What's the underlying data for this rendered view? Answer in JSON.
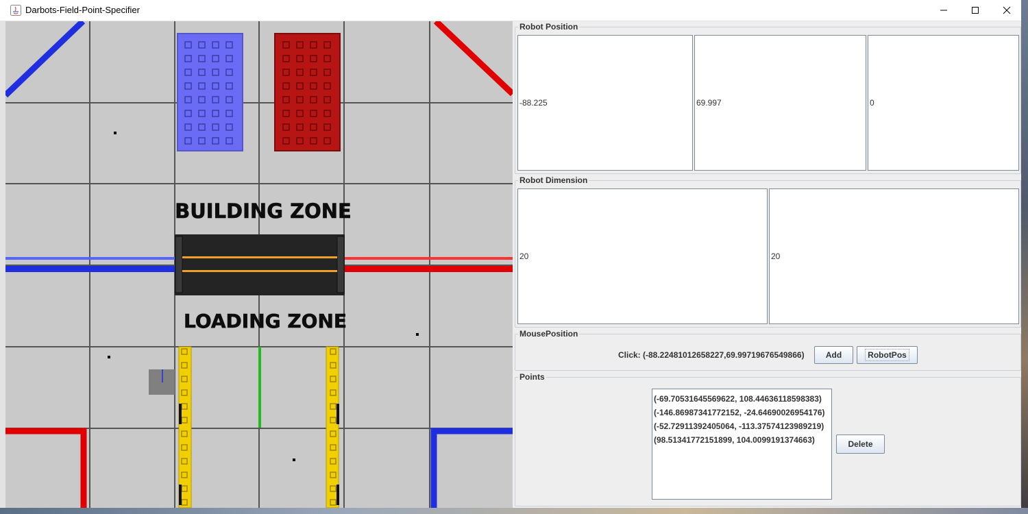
{
  "window": {
    "title": "Darbots-Field-Point-Specifier",
    "controls": [
      "minimize-icon",
      "maximize-icon",
      "close-icon"
    ]
  },
  "field": {
    "building_zone_label": "BUILDING ZONE",
    "loading_zone_label": "LOADING ZONE",
    "colors": {
      "mat": "#c9c9c9",
      "blue": "#1f2fe0",
      "red": "#e00000",
      "yellow": "#f2d000",
      "bridge": "#242424",
      "green": "#22bb22",
      "robot": "#808080"
    }
  },
  "robot_position": {
    "title": "Robot Position",
    "x": "-88.225",
    "y": "69.997",
    "rotation": "0"
  },
  "robot_dimension": {
    "title": "Robot Dimension",
    "width": "20",
    "height": "20"
  },
  "mouse_position": {
    "title": "MousePosition",
    "click_text": "Click: (-88.22481012658227,69.99719676549866)",
    "add_label": "Add",
    "robotpos_label": "RobotPos"
  },
  "points": {
    "title": "Points",
    "items": [
      "(-69.70531645569622, 108.44636118598383)",
      "(-146.86987341772152, -24.64690026954176)",
      "(-52.72911392405064, -113.37574123989219)",
      "(98.51341772151899, 104.0099191374663)"
    ],
    "delete_label": "Delete"
  }
}
